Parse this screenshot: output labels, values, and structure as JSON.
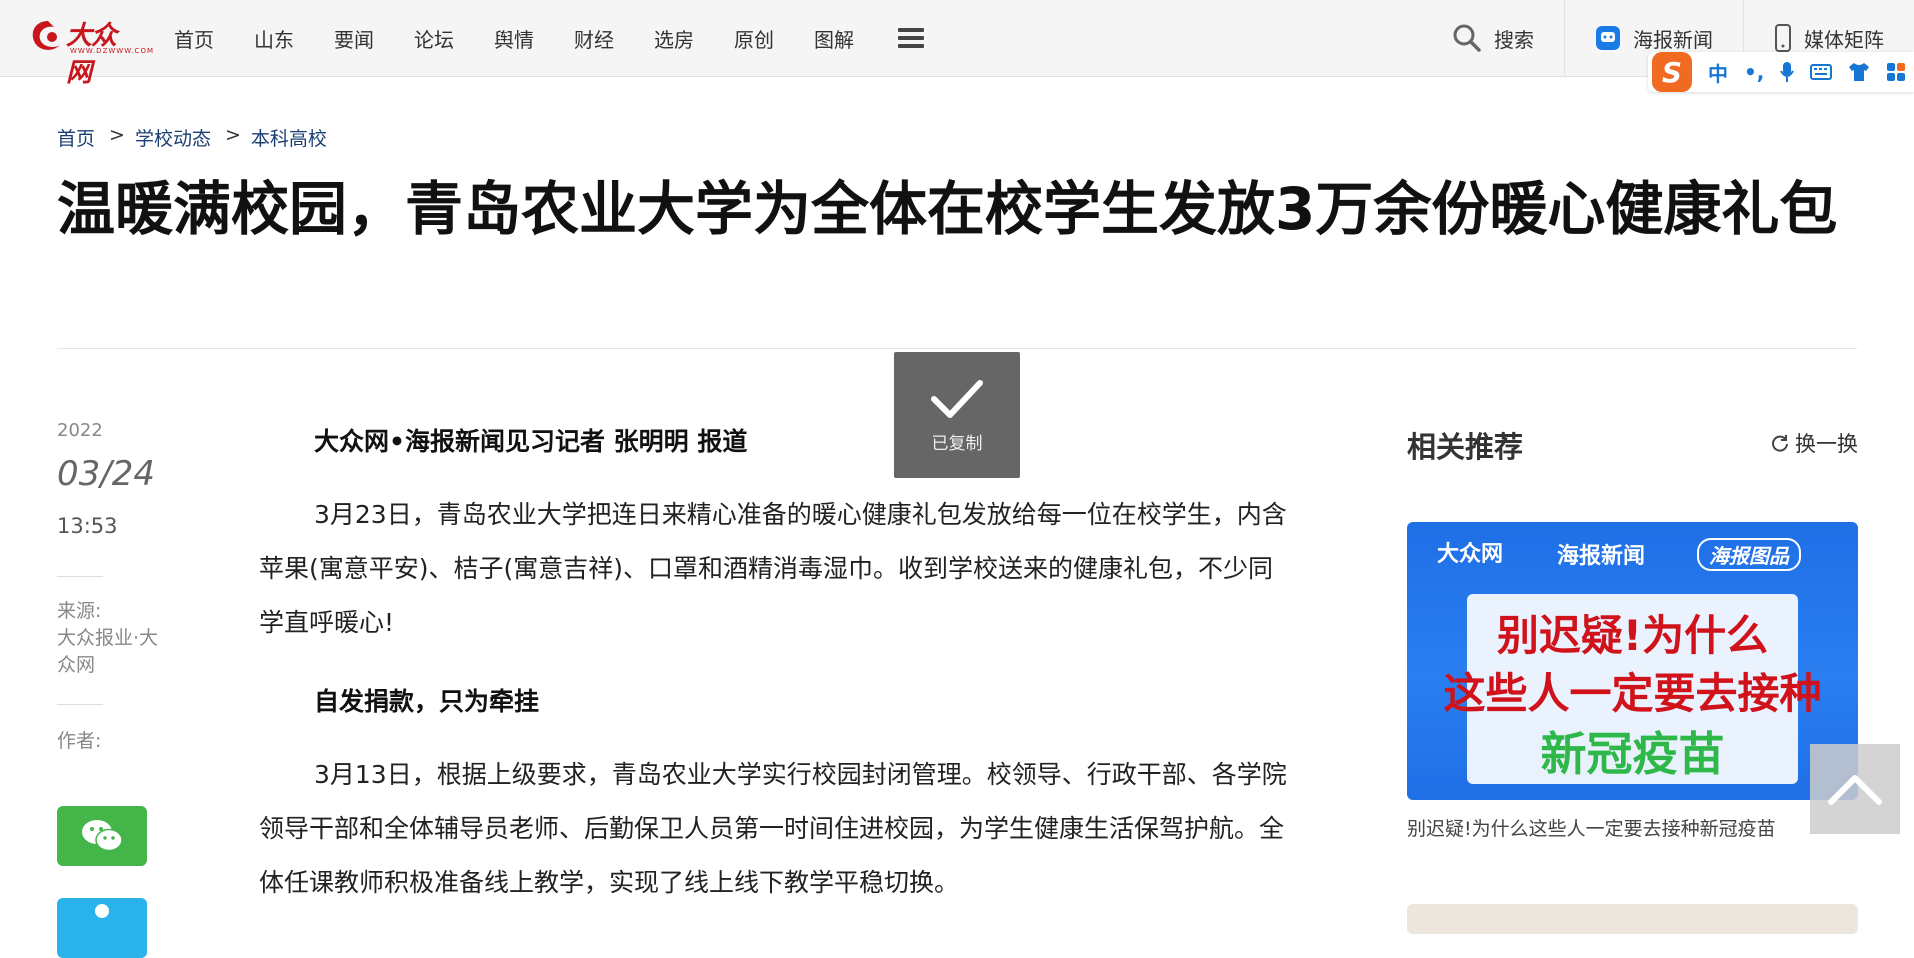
{
  "header": {
    "logo_text": "大众网",
    "logo_sub": "WWW.DZWWW.COM",
    "nav": [
      "首页",
      "山东",
      "要闻",
      "论坛",
      "舆情",
      "财经",
      "选房",
      "原创",
      "图解"
    ],
    "search_label": "搜索",
    "poster_news_label": "海报新闻",
    "media_matrix_label": "媒体矩阵"
  },
  "ime": {
    "logo": "S",
    "mode": "中",
    "punct": "•,"
  },
  "breadcrumb": [
    "首页",
    "学校动态",
    "本科高校"
  ],
  "breadcrumb_sep": ">",
  "article": {
    "title": "温暖满校园，青岛农业大学为全体在校学生发放3万余份暖心健康礼包",
    "year": "2022",
    "date": "03/24",
    "time": "13:53",
    "source_label": "来源:",
    "source": "大众报业·大众网",
    "author_label": "作者:",
    "byline": "大众网•海报新闻见习记者 张明明 报道",
    "para1": "3月23日，青岛农业大学把连日来精心准备的暖心健康礼包发放给每一位在校学生，内含苹果(寓意平安)、桔子(寓意吉祥)、口罩和酒精消毒湿巾。收到学校送来的健康礼包，不少同学直呼暖心!",
    "subhead": "自发捐款，只为牵挂",
    "para2": "3月13日，根据上级要求，青岛农业大学实行校园封闭管理。校领导、行政干部、各学院领导干部和全体辅导员老师、后勤保卫人员第一时间住进校园，为学生健康生活保驾护航。全体任课教师积极准备线上教学，实现了线上线下教学平稳切换。"
  },
  "toast": {
    "text": "已复制"
  },
  "sidebar": {
    "title": "相关推荐",
    "refresh_label": "换一换",
    "image_brand1": "大众网",
    "image_brand2": "海报新闻",
    "image_brand3": "海报图品",
    "image_line1": "别迟疑!为什么",
    "image_line2": "这些人一定要去接种",
    "image_line3": "新冠疫苗",
    "caption": "别迟疑!为什么这些人一定要去接种新冠疫苗"
  }
}
